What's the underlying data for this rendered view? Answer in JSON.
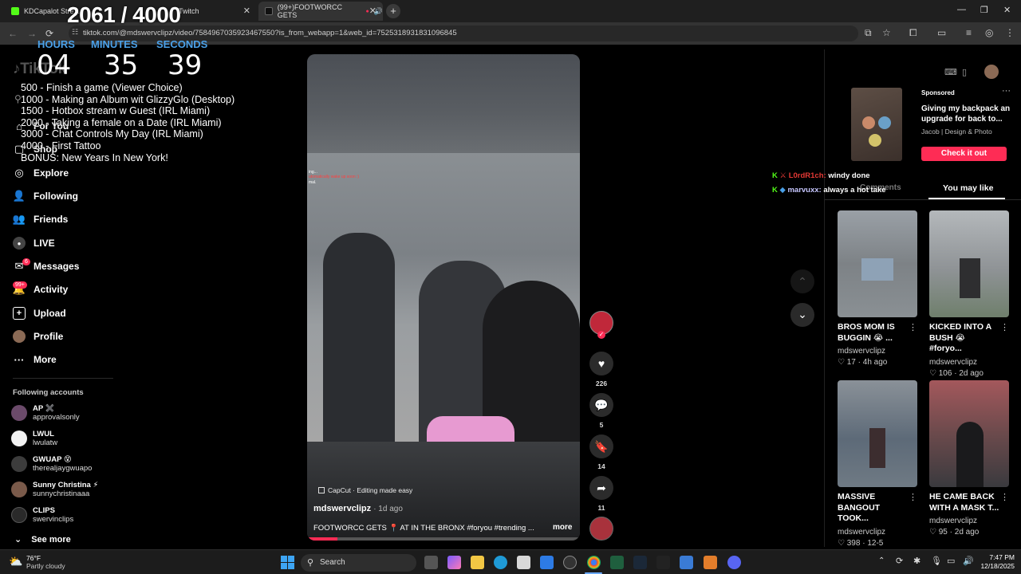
{
  "browser": {
    "tabs": [
      {
        "title": "KDCapalot Stre...",
        "extra": "Twitch",
        "active": false
      },
      {
        "title": "(99+)FOOTWORCC GETS",
        "active": true
      }
    ],
    "url": "tiktok.com/@mdswervclipz/video/7584967035923467550?is_from_webapp=1&web_id=7525318931831096845"
  },
  "overlay": {
    "sub_counter": "2061 / 4000",
    "timer": [
      {
        "label": "HOURS",
        "value": "04"
      },
      {
        "label": "MINUTES",
        "value": "35"
      },
      {
        "label": "SECONDS",
        "value": "39"
      }
    ],
    "goals": [
      "500 -  Finish a game (Viewer Choice)",
      "1000 - Making an Album wit GlizzyGlo (Desktop)",
      "1500 - Hotbox stream w Guest (IRL Miami)",
      "2000 - Taking a female on a Date (IRL Miami)",
      "3000 - Chat Controls My Day (IRL Miami)",
      "4000 - First Tattoo",
      "BONUS: New Years In New York!"
    ],
    "chat": [
      {
        "user": "L0rdR1ch:",
        "message": "windy done",
        "user_color": "#e53935"
      },
      {
        "user": "marvuxx:",
        "message": "always a hot take",
        "user_color": "#c7c7ff"
      }
    ]
  },
  "tiktok": {
    "logo": "TikTok",
    "nav": [
      {
        "label": "For You",
        "icon": "home-icon"
      },
      {
        "label": "Shop",
        "icon": "shop-icon"
      },
      {
        "label": "Explore",
        "icon": "compass-icon"
      },
      {
        "label": "Following",
        "icon": "following-icon"
      },
      {
        "label": "Friends",
        "icon": "friends-icon"
      },
      {
        "label": "LIVE",
        "icon": "live-icon"
      },
      {
        "label": "Messages",
        "icon": "messages-icon",
        "badge": "6"
      },
      {
        "label": "Activity",
        "icon": "activity-icon",
        "badge": "99+"
      },
      {
        "label": "Upload",
        "icon": "upload-icon"
      },
      {
        "label": "Profile",
        "icon": "avatar"
      },
      {
        "label": "More",
        "icon": "more-icon"
      }
    ],
    "following_header": "Following accounts",
    "accounts": [
      {
        "name": "AP ✖️",
        "handle": "approvalsonly"
      },
      {
        "name": "LWUL",
        "handle": "lwulatw"
      },
      {
        "name": "GWUAP 😵",
        "handle": "therealjaygwuapo"
      },
      {
        "name": "Sunny Christina ⚡",
        "handle": "sunnychristinaaa"
      },
      {
        "name": "CLIPS",
        "handle": "swervinclips"
      }
    ],
    "see_more": "See more",
    "video": {
      "author": "mdswervclipz",
      "age": "· 1d ago",
      "caption": "FOOTWORCC GETS 📍 AT IN THE BRONX #foryou #trending ...",
      "more": "more",
      "capcut": "CapCut · Editing made easy",
      "game_hud": [
        "ing...",
        "utomatically wake up soon :)",
        "mal."
      ],
      "likes": "226",
      "comments": "5",
      "saves": "14",
      "shares": "11"
    },
    "ad": {
      "sponsored": "Sponsored",
      "title": "Giving my backpack an upgrade for back to...",
      "advertiser": "Jacob | Design & Photo",
      "cta": "Check it out"
    },
    "panel_tabs": {
      "comments": "Comments",
      "you_may_like": "You may like"
    },
    "recommended": [
      {
        "title": "BROS MOM IS BUGGIN 😭 ...",
        "user": "mdswervclipz",
        "likes": "17",
        "age": "4h ago"
      },
      {
        "title": "KICKED INTO A BUSH 😭 #foryo...",
        "user": "mdswervclipz",
        "likes": "106",
        "age": "2d ago"
      },
      {
        "title": "MASSIVE BANGOUT TOOK...",
        "user": "mdswervclipz",
        "likes": "398",
        "age": "12-5"
      },
      {
        "title": "HE CAME BACK WITH A MASK T...",
        "user": "mdswervclipz",
        "likes": "95",
        "age": "2d ago"
      }
    ]
  },
  "taskbar": {
    "weather_temp": "76°F",
    "weather_desc": "Partly cloudy",
    "search": "Search",
    "time": "7:47 PM",
    "date": "12/18/2025"
  },
  "colors": {
    "tiktok_red": "#fe2c55",
    "timer_label": "#4aa0e8"
  }
}
